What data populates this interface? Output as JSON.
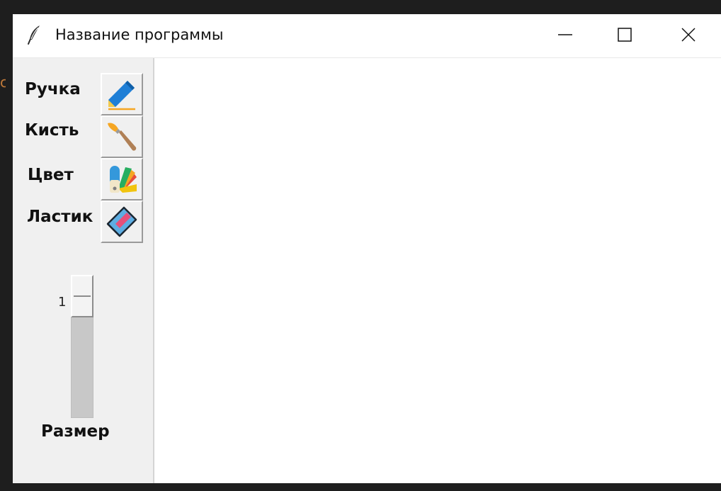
{
  "window": {
    "title": "Название программы",
    "app_icon": "feather-icon",
    "controls": [
      "minimize-icon",
      "maximize-icon",
      "close-icon"
    ]
  },
  "background": {
    "stray_text": "c"
  },
  "tools": [
    {
      "label": "Ручка",
      "icon": "pen-icon"
    },
    {
      "label": "Кисть",
      "icon": "brush-icon"
    },
    {
      "label": "Цвет",
      "icon": "color-palette-icon"
    },
    {
      "label": "Ластик",
      "icon": "eraser-icon"
    }
  ],
  "size_slider": {
    "value": "1",
    "label": "Размер"
  },
  "colors": {
    "sidebar_bg": "#f0f0f0",
    "canvas_bg": "#ffffff",
    "desktop_bg": "#1e1e1e"
  }
}
